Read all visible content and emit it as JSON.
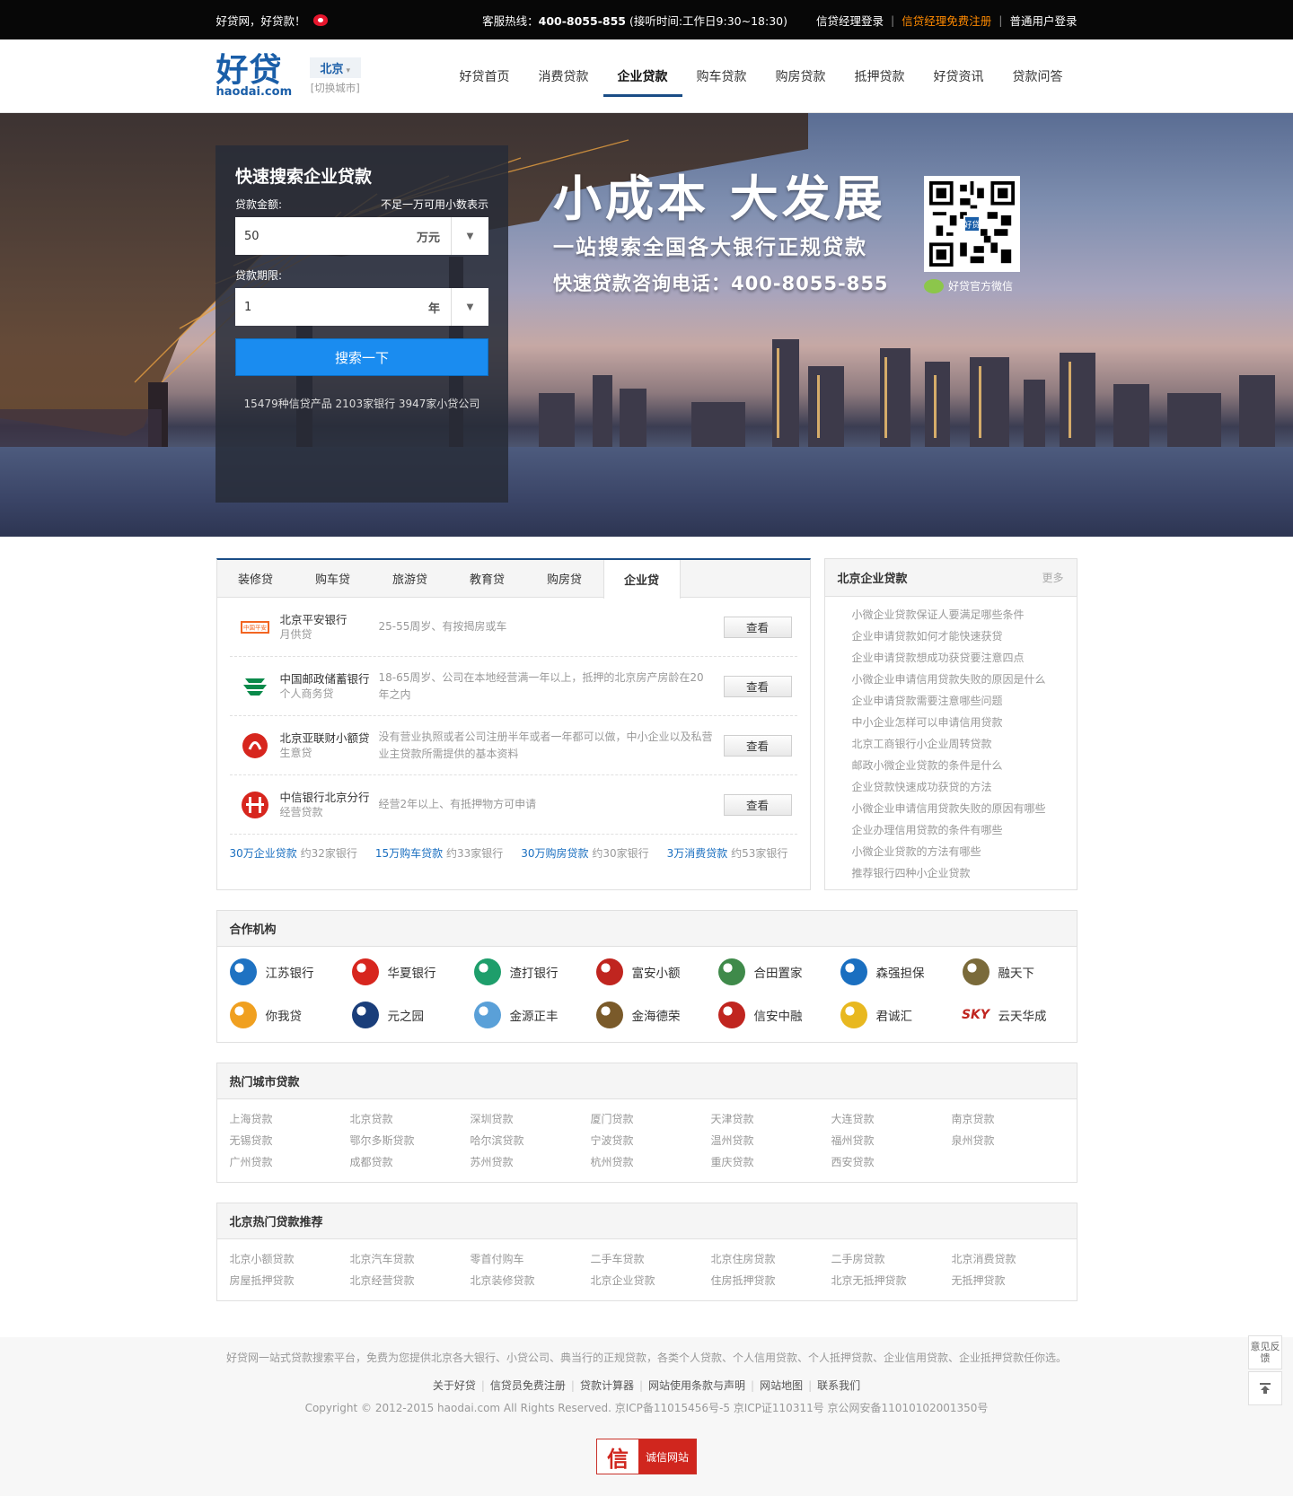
{
  "topbar": {
    "greeting": "好贷网，好贷款！",
    "hotline_label": "客服热线：",
    "hotline_number": "400-8055-855",
    "hotline_hours": "(接听时间:工作日9:30~18:30)",
    "login_manager": "信贷经理登录",
    "register_manager": "信贷经理免费注册",
    "login_user": "普通用户登录",
    "sep": "|"
  },
  "header": {
    "logo_cn": "好贷",
    "logo_en": "haodai.com",
    "city": "北京",
    "switch_city": "[切换城市]",
    "nav": [
      "好贷首页",
      "消费贷款",
      "企业贷款",
      "购车贷款",
      "购房贷款",
      "抵押贷款",
      "好贷资讯",
      "贷款问答"
    ],
    "nav_active_index": 2
  },
  "search": {
    "title": "快速搜索企业贷款",
    "amount_label": "贷款金额:",
    "amount_hint": "不足一万可用小数表示",
    "amount_value": "50",
    "amount_unit": "万元",
    "term_label": "贷款期限:",
    "term_value": "1",
    "term_unit": "年",
    "button": "搜索一下",
    "stats": "15479种信贷产品 2103家银行 3947家小贷公司"
  },
  "banner": {
    "slogan": "小成本 大发展",
    "subtitle": "一站搜索全国各大银行正规贷款",
    "phone": "快速贷款咨询电话：400-8055-855",
    "qr_caption": "好贷官方微信",
    "qr_badge": "好贷"
  },
  "loan_tabs": {
    "tabs": [
      "装修贷",
      "购车贷",
      "旅游贷",
      "教育贷",
      "购房贷",
      "企业贷"
    ],
    "active_index": 5,
    "products": [
      {
        "bank": "北京平安银行",
        "product": "月供贷",
        "desc": "25-55周岁、有按揭房或车",
        "button": "查看",
        "logo": "pingan-bank-logo",
        "logo_text": "中国平安"
      },
      {
        "bank": "中国邮政储蓄银行",
        "product": "个人商务贷",
        "desc": "18-65周岁、公司在本地经营满一年以上，抵押的北京房产房龄在20年之内",
        "button": "查看",
        "logo": "postal-bank-logo"
      },
      {
        "bank": "北京亚联财小额贷",
        "product": "生意贷",
        "desc": "没有营业执照或者公司注册半年或者一年都可以做，中小企业以及私营业主贷款所需提供的基本资料",
        "button": "查看",
        "logo": "yalian-logo"
      },
      {
        "bank": "中信银行北京分行",
        "product": "经营贷款",
        "desc": "经营2年以上、有抵押物方可申请",
        "button": "查看",
        "logo": "citic-bank-logo"
      }
    ],
    "quick_links": [
      {
        "link": "30万企业贷款",
        "count": "约32家银行"
      },
      {
        "link": "15万购车贷款",
        "count": "约33家银行"
      },
      {
        "link": "30万购房贷款",
        "count": "约30家银行"
      },
      {
        "link": "3万消费贷款",
        "count": "约53家银行"
      }
    ]
  },
  "news": {
    "title": "北京企业贷款",
    "more": "更多",
    "items": [
      "小微企业贷款保证人要满足哪些条件",
      "企业申请贷款如何才能快速获贷",
      "企业申请贷款想成功获贷要注意四点",
      "小微企业申请信用贷款失败的原因是什么",
      "企业申请贷款需要注意哪些问题",
      "中小企业怎样可以申请信用贷款",
      "北京工商银行小企业周转贷款",
      "邮政小微企业贷款的条件是什么",
      "企业贷款快速成功获贷的方法",
      "小微企业申请信用贷款失败的原因有哪些",
      "企业办理信用贷款的条件有哪些",
      "小微企业贷款的方法有哪些",
      "推荐银行四种小企业贷款"
    ]
  },
  "partners": {
    "title": "合作机构",
    "items": [
      {
        "name": "江苏银行",
        "logo": "jiangsu-bank-logo",
        "color": "#1e72c2"
      },
      {
        "name": "华夏银行",
        "logo": "huaxia-bank-logo",
        "color": "#d7261e"
      },
      {
        "name": "渣打银行",
        "logo": "standard-chartered-logo",
        "color": "#1e9e6b"
      },
      {
        "name": "富安小额",
        "logo": "fuan-logo",
        "color": "#c0251f"
      },
      {
        "name": "合田置家",
        "logo": "hetian-logo",
        "color": "#3f8a4a"
      },
      {
        "name": "森强担保",
        "logo": "senqiang-logo",
        "color": "#1a6fc0"
      },
      {
        "name": "融天下",
        "logo": "rongtianxia-logo",
        "color": "#7a6a3a"
      },
      {
        "name": "你我贷",
        "logo": "niwodai-logo",
        "color": "#f0a020"
      },
      {
        "name": "元之园",
        "logo": "yuanzhiyuan-logo",
        "color": "#1a3e7a"
      },
      {
        "name": "金源正丰",
        "logo": "jinyuan-logo",
        "color": "#5aa0d8"
      },
      {
        "name": "金海德荣",
        "logo": "jinhai-logo",
        "color": "#7a5a2a"
      },
      {
        "name": "信安中融",
        "logo": "xinan-logo",
        "color": "#c0251f"
      },
      {
        "name": "君诚汇",
        "logo": "junchenghui-logo",
        "color": "#e8b820"
      },
      {
        "name": "云天华成",
        "logo": "yuntian-logo",
        "color": "#c0251f",
        "logo_text": "SKY"
      }
    ]
  },
  "hot_cities": {
    "title": "热门城市贷款",
    "items": [
      "上海贷款",
      "北京贷款",
      "深圳贷款",
      "厦门贷款",
      "天津贷款",
      "大连贷款",
      "南京贷款",
      "无锡贷款",
      "鄂尔多斯贷款",
      "哈尔滨贷款",
      "宁波贷款",
      "温州贷款",
      "福州贷款",
      "泉州贷款",
      "广州贷款",
      "成都贷款",
      "苏州贷款",
      "杭州贷款",
      "重庆贷款",
      "西安贷款"
    ]
  },
  "hot_loans": {
    "title": "北京热门贷款推荐",
    "items": [
      "北京小额贷款",
      "北京汽车贷款",
      "零首付购车",
      "二手车贷款",
      "北京住房贷款",
      "二手房贷款",
      "北京消费贷款",
      "房屋抵押贷款",
      "北京经营贷款",
      "北京装修贷款",
      "北京企业贷款",
      "住房抵押贷款",
      "北京无抵押贷款",
      "无抵押贷款"
    ]
  },
  "footer": {
    "desc": "好贷网一站式贷款搜索平台，免费为您提供北京各大银行、小贷公司、典当行的正规贷款，各类个人贷款、个人信用贷款、个人抵押贷款、企业信用贷款、企业抵押贷款任你选。",
    "links": [
      "关于好贷",
      "信贷员免费注册",
      "贷款计算器",
      "网站使用条款与声明",
      "网站地图",
      "联系我们"
    ],
    "copyright": "Copyright © 2012-2015 haodai.com All Rights Reserved. 京ICP备11015456号-5 京ICP证110311号 京公网安备11010102001350号",
    "credit_icon": "信",
    "credit_label": "诚信网站"
  },
  "side": {
    "feedback": "意见反馈",
    "top_icon": "back-to-top-icon"
  },
  "colors": {
    "brand_blue": "#1a5ea8",
    "accent_orange": "#ff8a00",
    "search_button": "#1a8cf0",
    "link_blue": "#1a6fc0"
  }
}
